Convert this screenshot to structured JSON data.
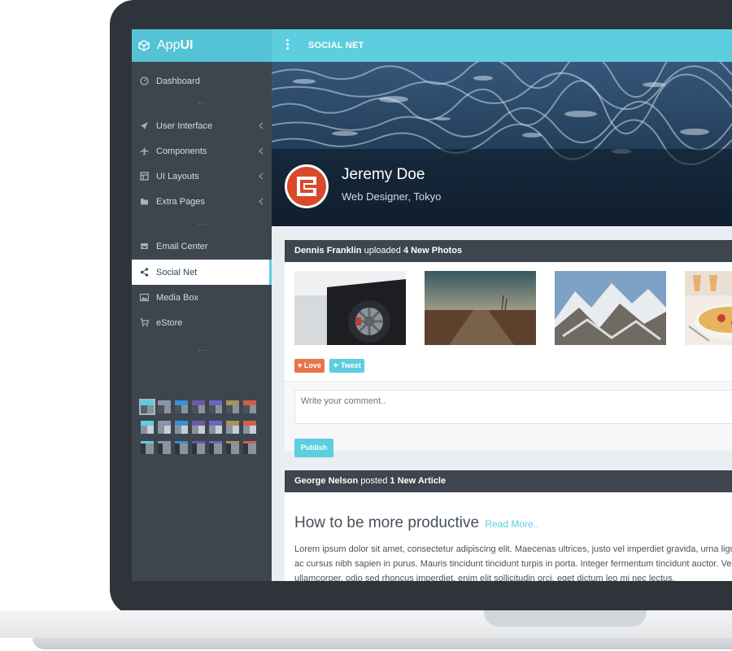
{
  "app": {
    "brand_prefix": "App",
    "brand_suffix": "UI",
    "page_title": "SOCIAL NET"
  },
  "sidebar": {
    "items": [
      {
        "label": "Dashboard",
        "icon": "dashboard-icon"
      },
      {
        "label": "User Interface",
        "icon": "rocket-icon"
      },
      {
        "label": "Components",
        "icon": "airplane-icon"
      },
      {
        "label": "UI Layouts",
        "icon": "layout-icon"
      },
      {
        "label": "Extra Pages",
        "icon": "folder-icon"
      },
      {
        "label": "Email Center",
        "icon": "inbox-icon"
      },
      {
        "label": "Social Net",
        "icon": "share-icon"
      },
      {
        "label": "Media Box",
        "icon": "image-icon"
      },
      {
        "label": "eStore",
        "icon": "cart-icon"
      }
    ],
    "active": "Social Net",
    "theme_colors": [
      "#5ccee0",
      "#8a96a3",
      "#3a8fd9",
      "#7357a5",
      "#6e63c7",
      "#a89060",
      "#d25f4a"
    ]
  },
  "profile": {
    "name": "Jeremy Doe",
    "role": "Web Designer, Tokyo"
  },
  "post1": {
    "author": "Dennis Franklin",
    "action": "uploaded",
    "object": "4 New Photos",
    "love_label": "Love",
    "tweet_label": "Tweet",
    "comment_placeholder": "Write your comment..",
    "publish_label": "Publish"
  },
  "post2": {
    "author": "George Nelson",
    "action": "posted",
    "object": "1 New Article",
    "title": "How to be more productive",
    "read_more": "Read More..",
    "line1": "Lorem ipsum dolor sit amet, consectetur adipiscing elit. Maecenas ultrices, justo vel imperdiet gravida, urna ligula",
    "line2": "ac cursus nibh sapien in purus. Mauris tincidunt tincidunt turpis in porta. Integer fermentum tincidunt auctor. Vest",
    "line3": "ullamcorper, odio sed rhoncus imperdiet, enim elit sollicitudin orci, eget dictum leo mi nec lectus."
  },
  "colors": {
    "accent": "#5ccee0",
    "sidebar": "#3d454e",
    "love": "#e9744a"
  }
}
